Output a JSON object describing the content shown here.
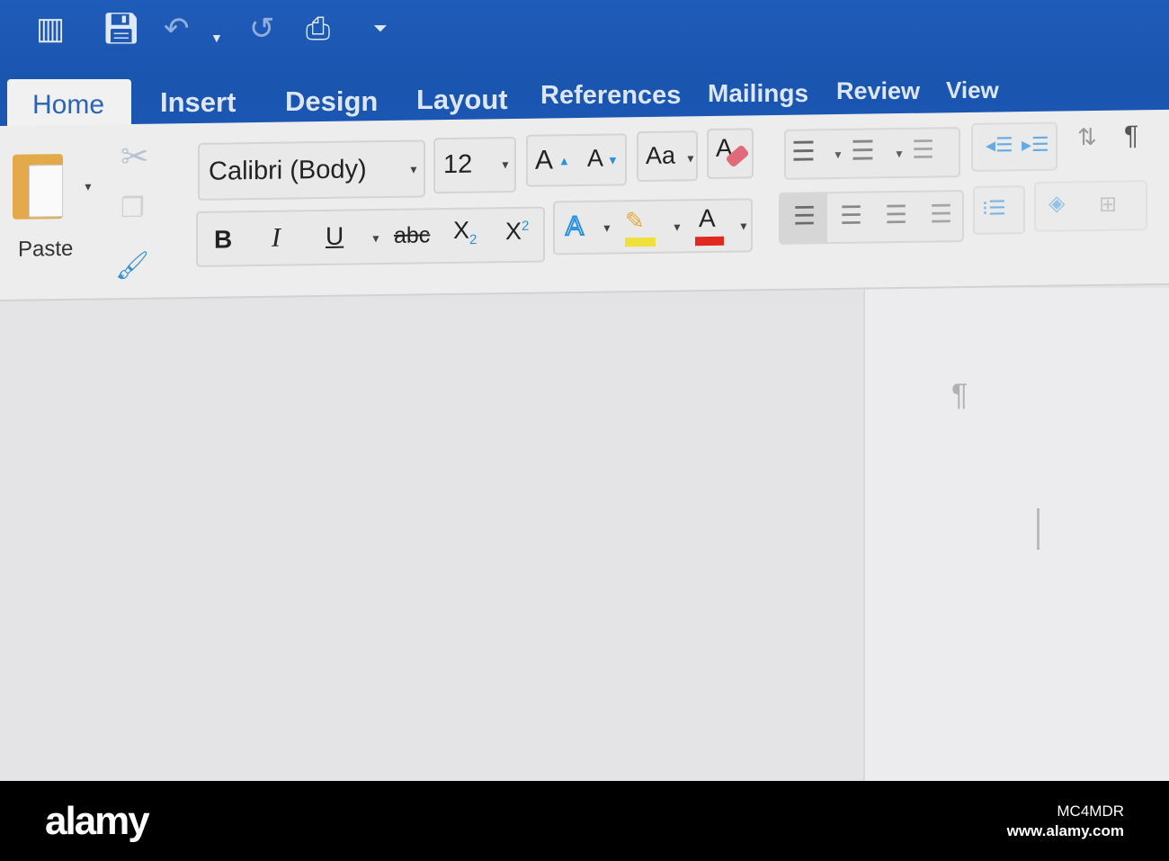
{
  "quick_access": {
    "icons": [
      "sidebar-icon",
      "save-icon",
      "undo-icon",
      "redo-icon",
      "print-icon",
      "customize-icon"
    ]
  },
  "tabs": [
    "Home",
    "Insert",
    "Design",
    "Layout",
    "References",
    "Mailings",
    "Review",
    "View"
  ],
  "clipboard": {
    "paste_label": "Paste"
  },
  "font": {
    "name": "Calibri (Body)",
    "size": "12"
  },
  "format_buttons": {
    "bold": "B",
    "italic": "I",
    "underline": "U",
    "strike": "abc",
    "subscript": "X",
    "sub_mark": "2",
    "superscript": "X",
    "sup_mark": "2",
    "grow": "A",
    "shrink": "A",
    "change_case": "Aa",
    "clear": "A",
    "effects": "A",
    "highlight_color": "#f2e03a",
    "font_color": "A",
    "font_color_value": "#e0291f"
  },
  "colors": {
    "brand": "#1b57b3",
    "accent": "#2b8fe0"
  },
  "footer": {
    "logo": "alamy",
    "image_id": "MC4MDR",
    "url": "www.alamy.com"
  }
}
